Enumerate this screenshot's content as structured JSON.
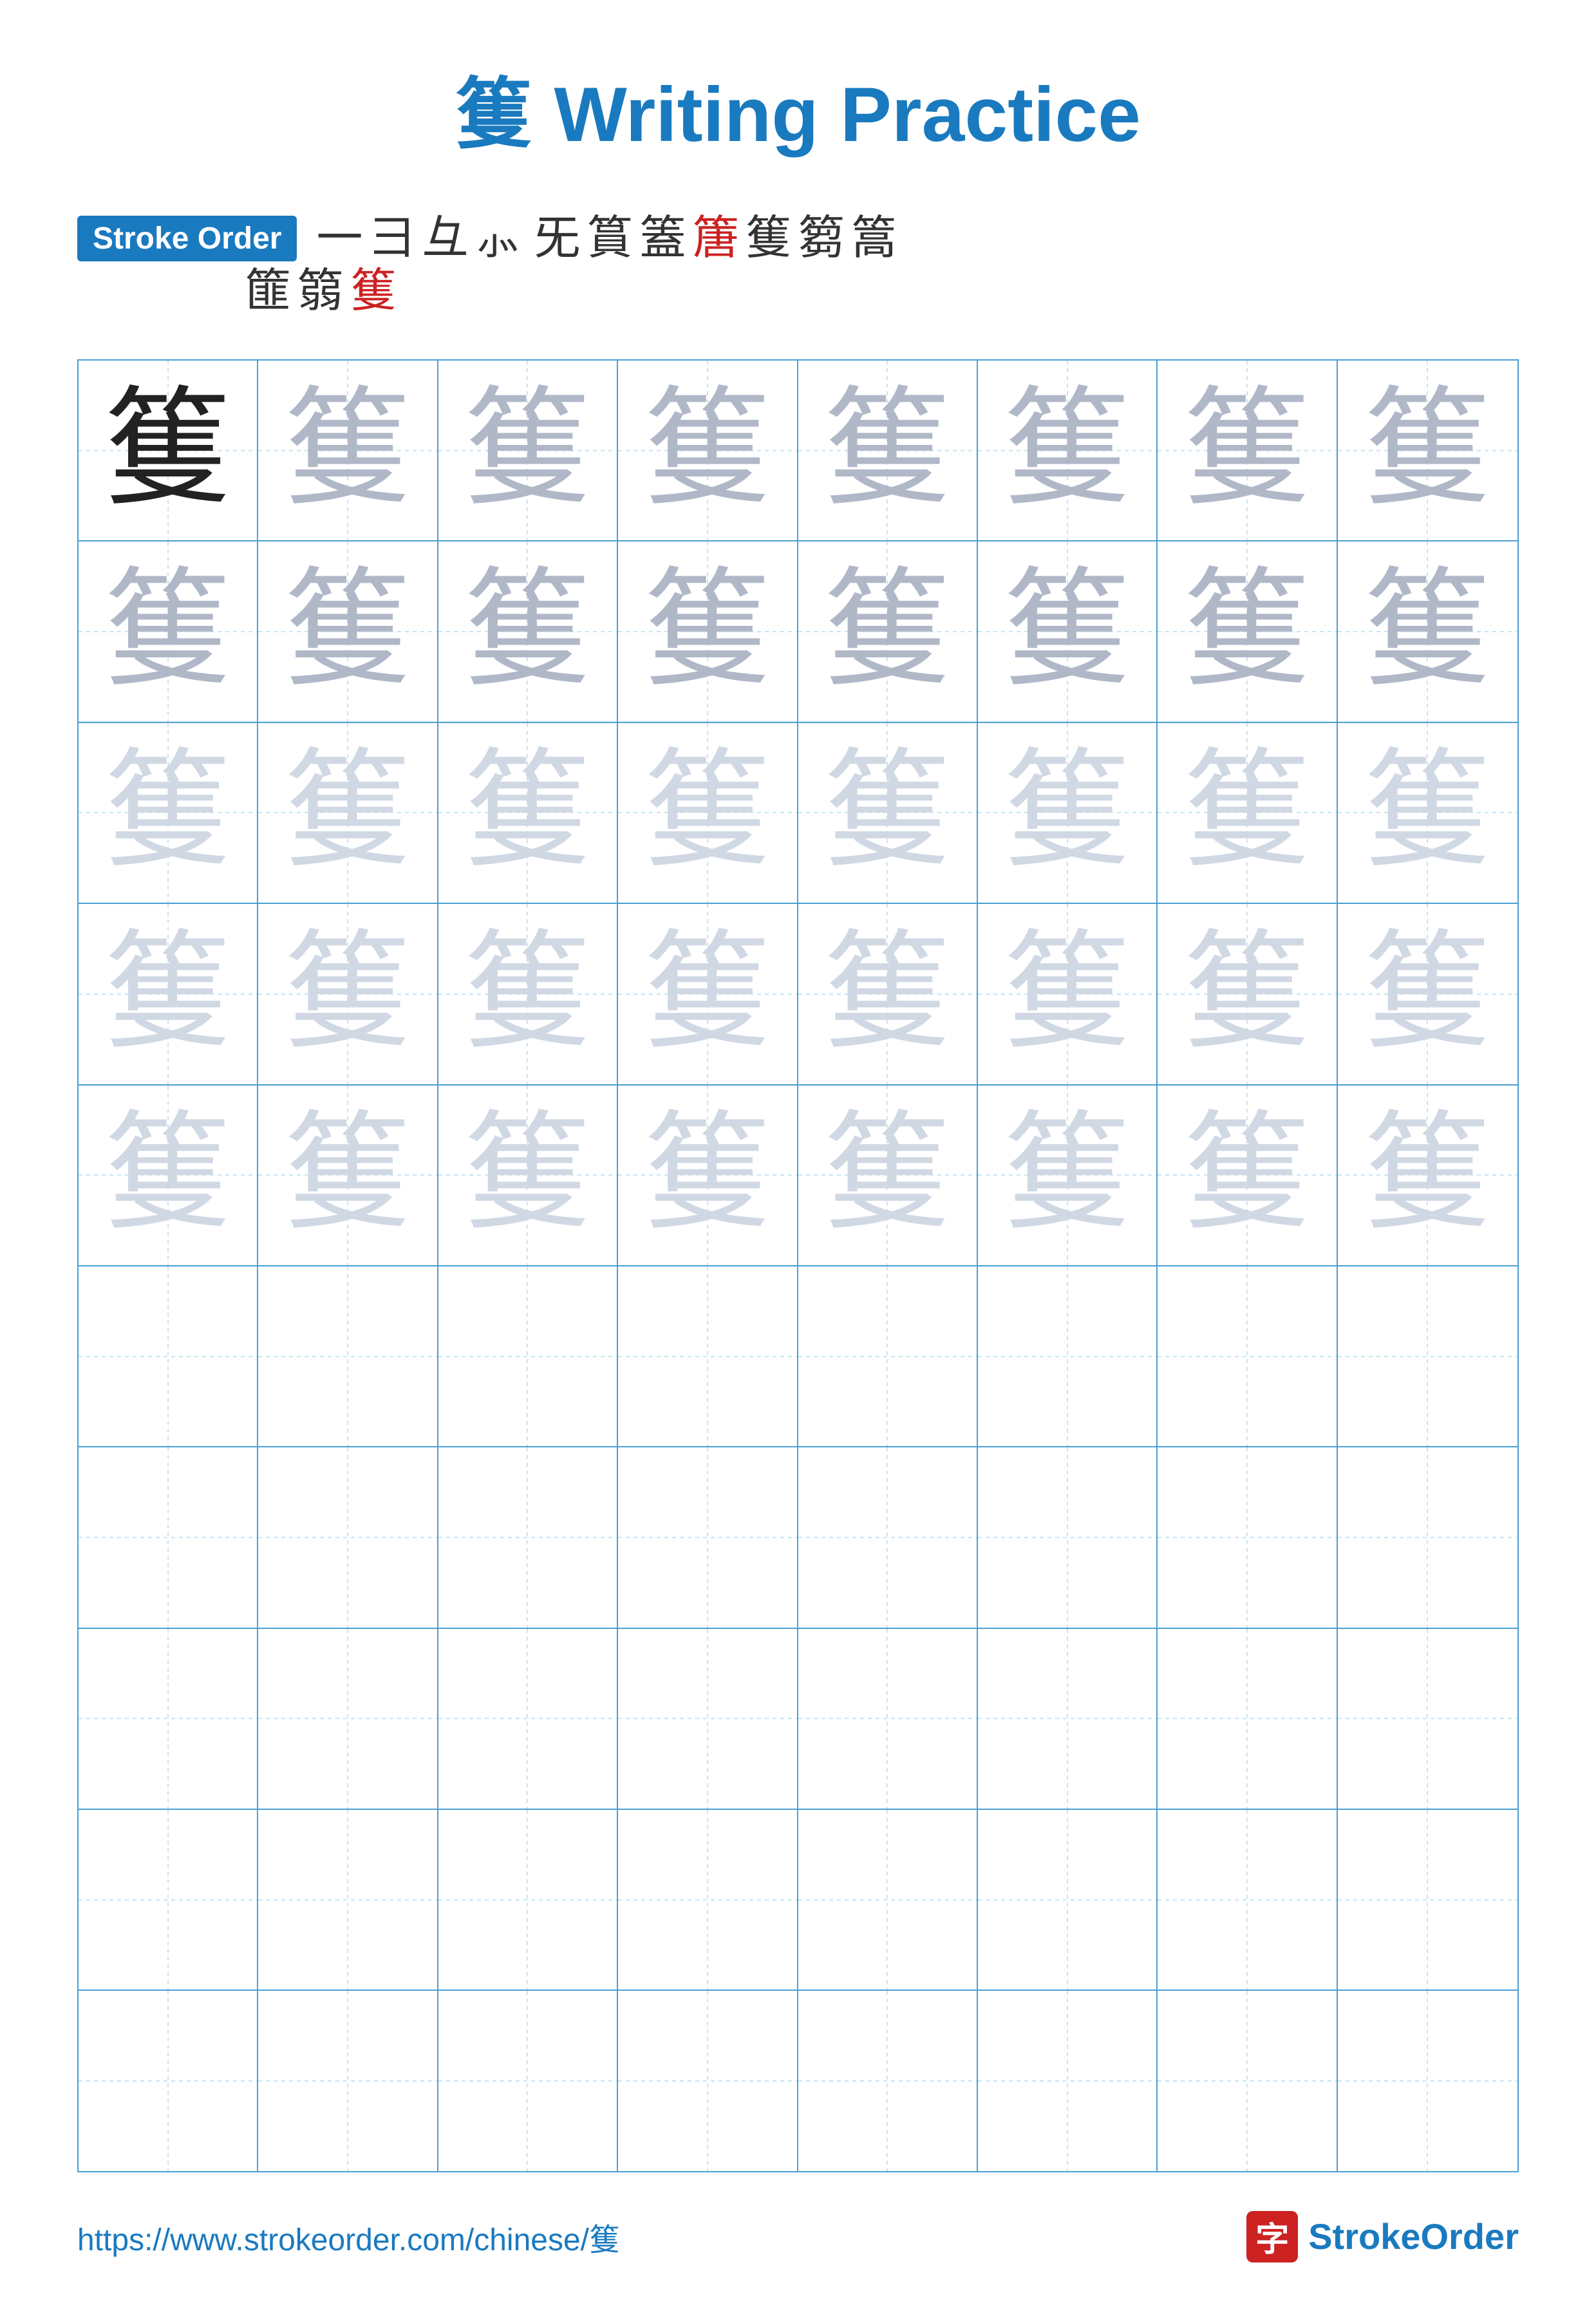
{
  "title": "篗 Writing Practice",
  "strokeOrderBadge": "Stroke Order",
  "strokeChars": [
    "⼀",
    "ㄅ",
    "ㄆ",
    "ㄉ",
    "ㄊ",
    "ㄋㄊ",
    "篔",
    "篕",
    "篖",
    "篗",
    "篘",
    "篙",
    "篚",
    "篛",
    "篗"
  ],
  "mainChar": "篗",
  "guideChar": "篗",
  "rows": [
    {
      "cells": [
        "dark",
        "medium",
        "medium",
        "medium",
        "medium",
        "medium",
        "medium",
        "medium"
      ]
    },
    {
      "cells": [
        "medium",
        "medium",
        "medium",
        "medium",
        "medium",
        "medium",
        "medium",
        "medium"
      ]
    },
    {
      "cells": [
        "light",
        "light",
        "light",
        "light",
        "light",
        "light",
        "light",
        "light"
      ]
    },
    {
      "cells": [
        "light",
        "light",
        "light",
        "light",
        "light",
        "light",
        "light",
        "light"
      ]
    },
    {
      "cells": [
        "light",
        "light",
        "light",
        "light",
        "light",
        "light",
        "light",
        "light"
      ]
    },
    {
      "cells": [
        "empty",
        "empty",
        "empty",
        "empty",
        "empty",
        "empty",
        "empty",
        "empty"
      ]
    },
    {
      "cells": [
        "empty",
        "empty",
        "empty",
        "empty",
        "empty",
        "empty",
        "empty",
        "empty"
      ]
    },
    {
      "cells": [
        "empty",
        "empty",
        "empty",
        "empty",
        "empty",
        "empty",
        "empty",
        "empty"
      ]
    },
    {
      "cells": [
        "empty",
        "empty",
        "empty",
        "empty",
        "empty",
        "empty",
        "empty",
        "empty"
      ]
    },
    {
      "cells": [
        "empty",
        "empty",
        "empty",
        "empty",
        "empty",
        "empty",
        "empty",
        "empty"
      ]
    }
  ],
  "footer": {
    "url": "https://www.strokeorder.com/chinese/篗",
    "brandIconChar": "字",
    "brandName": "StrokeOrder",
    "brandHighlight": "Stroke"
  }
}
